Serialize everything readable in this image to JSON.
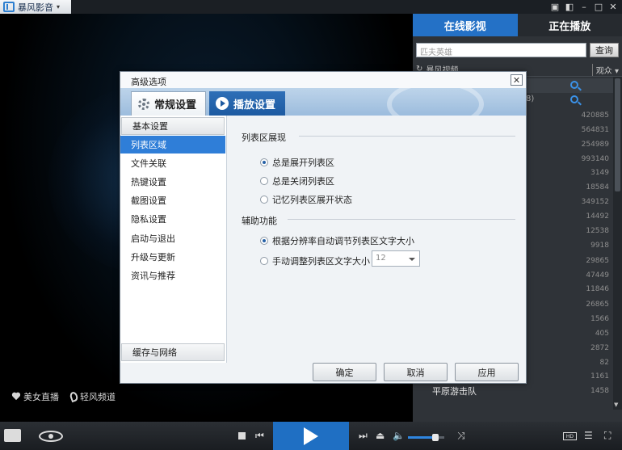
{
  "app": {
    "brand_name": "暴风影音",
    "brand_caret": "▾"
  },
  "window_controls": {
    "chat": "▣",
    "skin": "◧",
    "minimize": "–",
    "maximize": "□",
    "close": "✕"
  },
  "video": {
    "links": [
      {
        "label": "美女直播"
      },
      {
        "label": "轻风频道"
      }
    ]
  },
  "right_panel": {
    "tabs": [
      {
        "label": "在线影视"
      },
      {
        "label": "正在播放"
      }
    ],
    "search": {
      "placeholder": "匹夫英雄",
      "button": "查询"
    },
    "filter": {
      "refresh": "↻",
      "label": "暴风视频",
      "sort": "观众 ▾"
    },
    "partial_text": "8)",
    "counts": [
      "420885",
      "564831",
      "254989",
      "993140",
      "3149",
      "18584",
      "349152",
      "14492",
      "12538",
      "9918",
      "29865",
      "47449",
      "11846",
      "26865",
      "1566",
      "405",
      "2872",
      "82",
      "1161",
      "1458"
    ],
    "visible_title": "平原游击队",
    "scroll_down": "▼"
  },
  "dialog": {
    "title": "高级选项",
    "close": "✕",
    "tabs": [
      {
        "label": "常规设置"
      },
      {
        "label": "播放设置"
      }
    ],
    "nav": [
      {
        "label": "基本设置",
        "kind": "group"
      },
      {
        "label": "列表区域",
        "kind": "selected"
      },
      {
        "label": "文件关联"
      },
      {
        "label": "热键设置"
      },
      {
        "label": "截图设置"
      },
      {
        "label": "隐私设置"
      },
      {
        "label": "启动与退出"
      },
      {
        "label": "升级与更新"
      },
      {
        "label": "资讯与推荐"
      }
    ],
    "nav_bottom": {
      "label": "缓存与网络"
    },
    "section1": {
      "title": "列表区展现",
      "options": [
        {
          "label": "总是展开列表区",
          "checked": true
        },
        {
          "label": "总是关闭列表区",
          "checked": false
        },
        {
          "label": "记忆列表区展开状态",
          "checked": false
        }
      ]
    },
    "section2": {
      "title": "辅助功能",
      "options": [
        {
          "label": "根据分辨率自动调节列表区文字大小",
          "checked": true
        },
        {
          "label": "手动调整列表区文字大小",
          "checked": false
        }
      ],
      "font_size_value": "12"
    },
    "buttons": {
      "ok": "确定",
      "cancel": "取消",
      "apply": "应用"
    }
  },
  "controls": {
    "prev": "⏮",
    "next": "⏭",
    "eject": "⏏",
    "volume": "🔈",
    "shuffle": "⤨",
    "hd": "HD",
    "list": "☰",
    "fullscreen": "⛶"
  }
}
